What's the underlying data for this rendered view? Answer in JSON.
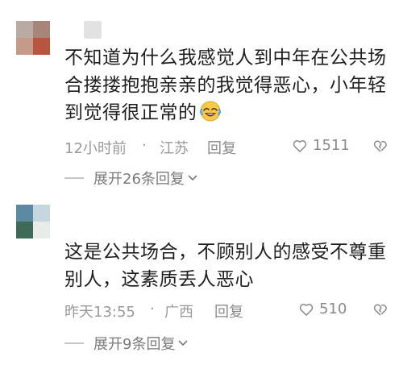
{
  "comments": [
    {
      "text": "不知道为什么我感觉人到中年在公共场合搂搂抱抱亲亲的我觉得恶心，小年轻到觉得很正常的",
      "emoji": "laughing-crying-emoji",
      "time": "12小时前",
      "separator": "·",
      "location": "江苏",
      "reply_label": "回复",
      "likes": "1511",
      "expand_label": "展开26条回复",
      "avatar_colors": [
        "#b9aaa3",
        "#a78578",
        "#c49a88",
        "#b8553e"
      ]
    },
    {
      "text": "这是公共场合，不顾别人的感受不尊重别人，这素质丢人恶心",
      "time": "昨天13:55",
      "separator": "·",
      "location": "广西",
      "reply_label": "回复",
      "likes": "510",
      "expand_label": "展开9条回复",
      "avatar_colors": [
        "#5c8aa3",
        "#c5d7de",
        "#3f6a58",
        "#e7ece9"
      ]
    }
  ],
  "colors": {
    "text_primary": "#1f1f1f",
    "text_meta": "#9a9a9a",
    "icon_gray": "#8a8a8a"
  }
}
